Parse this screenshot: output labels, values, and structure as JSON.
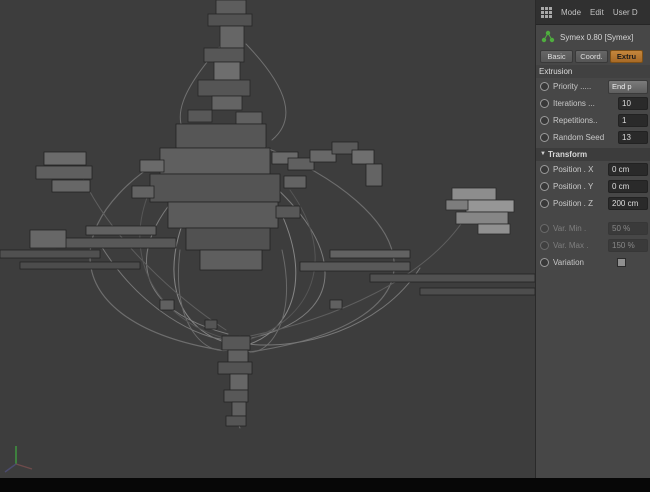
{
  "viewport": {
    "description": "3D perspective view with wireframe structure"
  },
  "panel": {
    "menu": {
      "items": [
        {
          "label": "Mode"
        },
        {
          "label": "Edit"
        },
        {
          "label": "User D"
        }
      ]
    },
    "object_title": "Symex 0.80 [Symex]",
    "tabs": [
      {
        "label": "Basic",
        "selected": false
      },
      {
        "label": "Coord.",
        "selected": false
      },
      {
        "label": "Extru",
        "selected": true
      }
    ],
    "sections": {
      "extrusion": {
        "title": "Extrusion",
        "rows": [
          {
            "label": "Priority .....",
            "value": "End p",
            "control": "dropdown"
          },
          {
            "label": "Iterations ...",
            "value": "10",
            "control": "number"
          },
          {
            "label": "Repetitions..",
            "value": "1",
            "control": "number"
          },
          {
            "label": "Random Seed",
            "value": "13",
            "control": "number"
          }
        ]
      },
      "transform": {
        "title": "Transform",
        "collapsed": false,
        "arrow": "▼",
        "rows": [
          {
            "label": "Position . X",
            "value": "0 cm",
            "disabled": false
          },
          {
            "label": "Position . Y",
            "value": "0 cm",
            "disabled": false
          },
          {
            "label": "Position . Z",
            "value": "200 cm",
            "disabled": false
          },
          {
            "label": "Var. Min .",
            "value": "50 %",
            "disabled": true
          },
          {
            "label": "Var. Max .",
            "value": "150 %",
            "disabled": true
          },
          {
            "label": "Variation",
            "control": "checkbox",
            "checked": false,
            "disabled": false
          }
        ]
      }
    }
  },
  "colors": {
    "viewport_bg": "#3d3d3d",
    "panel_bg": "#474747",
    "tab_selected": "#b5772e",
    "axis_green": "#3f9e3f"
  }
}
